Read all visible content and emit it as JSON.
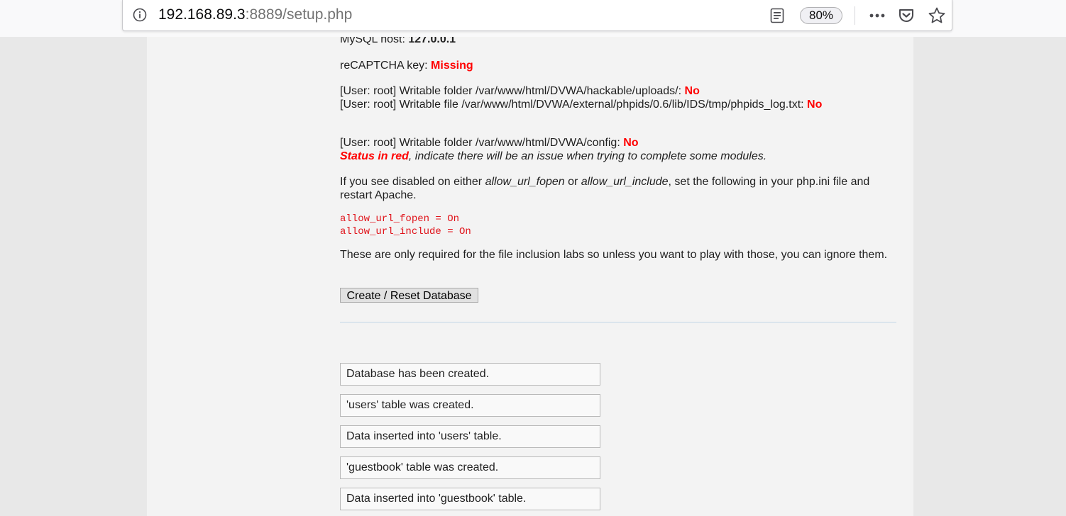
{
  "browser": {
    "url_host": "192.168.89.3",
    "url_rest": ":8889/setup.php",
    "zoom": "80%"
  },
  "setup": {
    "mysql_host_label": "MySQL host:",
    "mysql_host_value": "127.0.0.1",
    "recaptcha_label": "reCAPTCHA key:",
    "recaptcha_value": "Missing",
    "uploads_label": "[User: root] Writable folder /var/www/html/DVWA/hackable/uploads/:",
    "uploads_value": "No",
    "phpids_label": "[User: root] Writable file /var/www/html/DVWA/external/phpids/0.6/lib/IDS/tmp/phpids_log.txt:",
    "phpids_value": "No",
    "config_label": "[User: root] Writable folder /var/www/html/DVWA/config:",
    "config_value": "No",
    "status_red": "Status in red",
    "status_rest": ", indicate there will be an issue when trying to complete some modules.",
    "disabled_1": "If you see disabled on either ",
    "disabled_opt1": "allow_url_fopen",
    "disabled_2": " or ",
    "disabled_opt2": "allow_url_include",
    "disabled_3": ", set the following in your php.ini file and restart Apache.",
    "code_line_1": "allow_url_fopen = On",
    "code_line_2": "allow_url_include = On",
    "inclusion_note": "These are only required for the file inclusion labs so unless you want to play with those, you can ignore them.",
    "create_button": "Create / Reset Database"
  },
  "messages": [
    "Database has been created.",
    "'users' table was created.",
    "Data inserted into 'users' table.",
    "'guestbook' table was created.",
    "Data inserted into 'guestbook' table."
  ]
}
